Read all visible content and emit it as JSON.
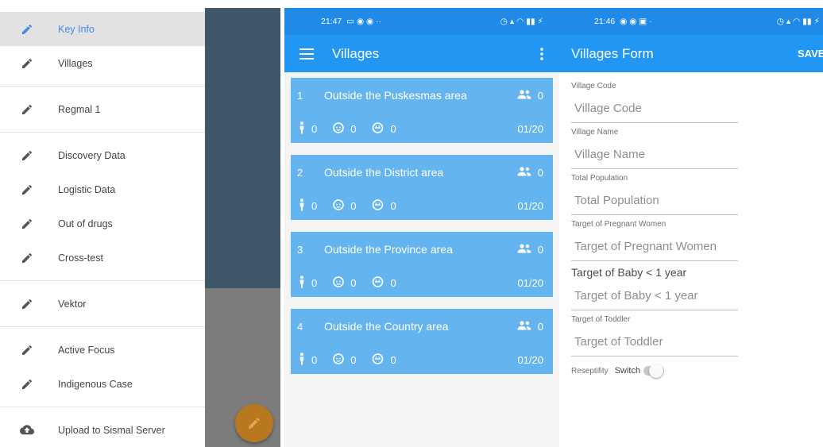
{
  "drawer": {
    "sections": [
      {
        "items": [
          {
            "label": "Key Info",
            "icon": "pencil-icon",
            "active": true
          },
          {
            "label": "Villages",
            "icon": "pencil-icon"
          }
        ]
      },
      {
        "items": [
          {
            "label": "Regmal 1",
            "icon": "pencil-icon"
          }
        ]
      },
      {
        "items": [
          {
            "label": "Discovery Data",
            "icon": "pencil-icon"
          },
          {
            "label": "Logistic Data",
            "icon": "pencil-icon"
          },
          {
            "label": "Out of drugs",
            "icon": "pencil-icon"
          },
          {
            "label": "Cross-test",
            "icon": "pencil-icon"
          }
        ]
      },
      {
        "items": [
          {
            "label": "Vektor",
            "icon": "pencil-icon"
          }
        ]
      },
      {
        "items": [
          {
            "label": "Active Focus",
            "icon": "pencil-icon"
          },
          {
            "label": "Indigenous Case",
            "icon": "pencil-icon"
          }
        ]
      },
      {
        "items": [
          {
            "label": "Upload to Sismal Server",
            "icon": "cloud-upload-icon"
          }
        ]
      }
    ]
  },
  "list_screen": {
    "status_time": "21:47",
    "status_left_icons": "▭ ◉ ◉ ··",
    "status_right_icons": "◷ ▴ ◠ ▮▮ ⚡",
    "title": "Villages",
    "villages": [
      {
        "number": "1",
        "name": "Outside the Puskesmas area",
        "members": "0",
        "pregnant": "0",
        "baby": "0",
        "toddler": "0",
        "date": "01/20"
      },
      {
        "number": "2",
        "name": "Outside the District area",
        "members": "0",
        "pregnant": "0",
        "baby": "0",
        "toddler": "0",
        "date": "01/20"
      },
      {
        "number": "3",
        "name": "Outside the Province area",
        "members": "0",
        "pregnant": "0",
        "baby": "0",
        "toddler": "0",
        "date": "01/20"
      },
      {
        "number": "4",
        "name": "Outside the Country area",
        "members": "0",
        "pregnant": "0",
        "baby": "0",
        "toddler": "0",
        "date": "01/20"
      }
    ]
  },
  "form_screen": {
    "status_time": "21:46",
    "status_left_icons": "◉ ◉ ▣ ·",
    "status_right_icons": "◷ ▴ ◠ ▮▮ ⚡",
    "title": "Villages Form",
    "save_label": "SAVE",
    "fields": [
      {
        "label": "Village Code",
        "placeholder": "Village Code",
        "value": ""
      },
      {
        "label": "Village Name",
        "placeholder": "Village Name",
        "value": ""
      },
      {
        "label": "Total Population",
        "placeholder": "Total Population",
        "value": ""
      },
      {
        "label": "Target of Pregnant Women",
        "placeholder": "Target of Pregnant Women",
        "value": ""
      },
      {
        "label": "Target of Baby < 1 year",
        "placeholder": "Target of Baby < 1 year",
        "value": "",
        "large_label": true
      },
      {
        "label": "Target of Toddler",
        "placeholder": "Target of Toddler",
        "value": ""
      }
    ],
    "receptivity_label": "Reseptifity",
    "switch_label": "Switch",
    "switch_on": false
  },
  "colors": {
    "primary": "#2196f3",
    "status_bar": "#1f8ae8",
    "card": "#64b4f0",
    "active_text": "#3d8ee0",
    "fab": "#b8781e",
    "scrim_dark": "#3f5869"
  }
}
